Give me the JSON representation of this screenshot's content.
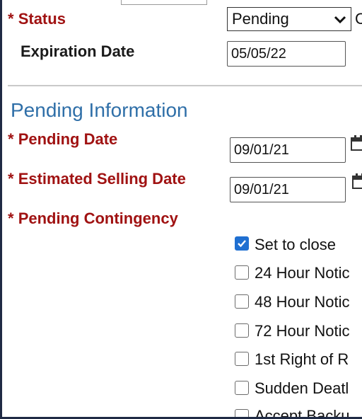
{
  "form": {
    "status": {
      "required_mark": "* ",
      "label": "Status",
      "value": "Pending",
      "trailing": "C"
    },
    "expiration": {
      "label": "Expiration Date",
      "value": "05/05/22"
    },
    "section_title": "Pending Information",
    "pending_date": {
      "required_mark": "* ",
      "label": "Pending Date",
      "value": "09/01/21"
    },
    "estimated_selling_date": {
      "required_mark": "* ",
      "label": "Estimated Selling Date",
      "value": "09/01/21"
    },
    "pending_contingency": {
      "required_mark": "* ",
      "label": "Pending Contingency",
      "options": [
        {
          "label": "Set to close",
          "checked": true
        },
        {
          "label": "24 Hour Notic",
          "checked": false
        },
        {
          "label": "48 Hour Notic",
          "checked": false
        },
        {
          "label": "72 Hour Notic",
          "checked": false
        },
        {
          "label": "1st Right of R",
          "checked": false
        },
        {
          "label": "Sudden Deatl",
          "checked": false
        },
        {
          "label": "Accept Backu",
          "checked": false
        }
      ]
    }
  },
  "icons": {
    "calendar": "calendar-icon",
    "dropdown": "chevron-down-icon"
  }
}
